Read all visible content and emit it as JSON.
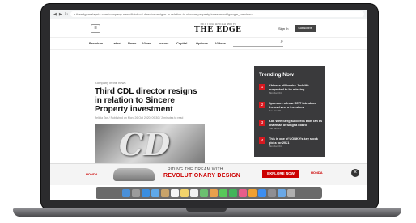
{
  "browser": {
    "url": "e.theedgemalaysia.com/company-news/third-cdl-director-resigns-in-relation-to-sincere-property-investment?google_preview=..."
  },
  "site": {
    "logo_top": "SETTING AHEAD WITH",
    "logo_main": "THE EDGE",
    "sign_in": "Sign In",
    "subscribe": "Subscribe"
  },
  "nav": {
    "items": [
      "Premium",
      "Latest",
      "News",
      "Views",
      "Issues",
      "Capital",
      "Options",
      "Videos"
    ]
  },
  "article": {
    "kicker": "Company in the news",
    "title": "Third CDL director resigns in relation to Sincere Property investment",
    "byline": "Felicia Tan / Published on Mon, 26 Oct 2020, 09:30 / 2 minutes to read"
  },
  "trending": {
    "heading": "Trending Now",
    "items": [
      {
        "num": "1",
        "text": "Chinese billionaire Jack Ma suspected to be missing",
        "date": "Mon Jan 04"
      },
      {
        "num": "2",
        "text": "Sponsors of new REIT introduce themselves to investors",
        "date": "Tue Jan 05"
      },
      {
        "num": "3",
        "text": "Koh Wee Seng succeeds Boh Tan as chairman of Singha board",
        "date": "Tue Jan 05"
      },
      {
        "num": "4",
        "text": "This is one of UOBKH's key stock picks for 2021",
        "date": "Mon Jan 04"
      }
    ]
  },
  "ad": {
    "brand": "HONDA",
    "line1": "RIDING THE DREAM WITH",
    "line2": "REVOLUTIONARY DESIGN",
    "cta": "EXPLORE NOW",
    "close": "×"
  },
  "colors": {
    "accent": "#d71920",
    "trending_bg": "#3a3a3c"
  },
  "dock": {
    "icons": [
      "finder-icon",
      "launchpad-icon",
      "safari-icon",
      "mail-icon",
      "contacts-icon",
      "calendar-icon",
      "notes-icon",
      "reminders-icon",
      "maps-icon",
      "photos-icon",
      "messages-icon",
      "facetime-icon",
      "itunes-icon",
      "books-icon",
      "appstore-icon",
      "settings-icon",
      "folder-icon",
      "trash-icon"
    ]
  }
}
